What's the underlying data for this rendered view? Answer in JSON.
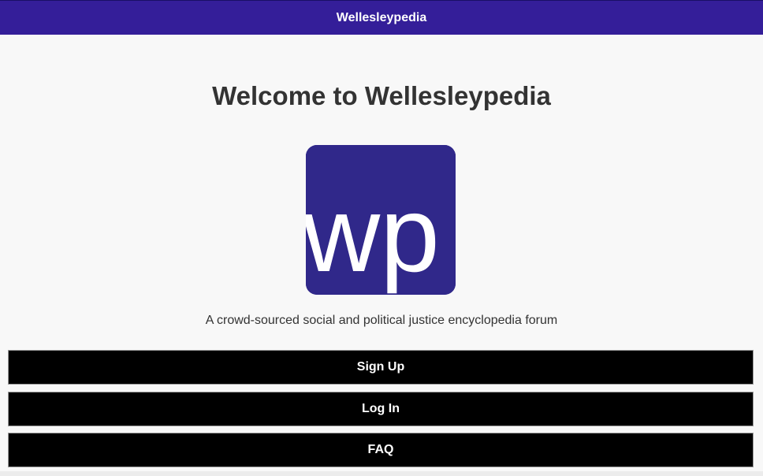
{
  "header": {
    "title": "Wellesleypedia",
    "background": "#341e99"
  },
  "main": {
    "welcome_title": "Welcome to Wellesleypedia",
    "logo": {
      "text": "wp",
      "background": "#30288a"
    },
    "tagline": "A crowd-sourced social and political justice encyclopedia forum"
  },
  "buttons": {
    "signup_label": "Sign Up",
    "login_label": "Log In",
    "faq_label": "FAQ"
  }
}
